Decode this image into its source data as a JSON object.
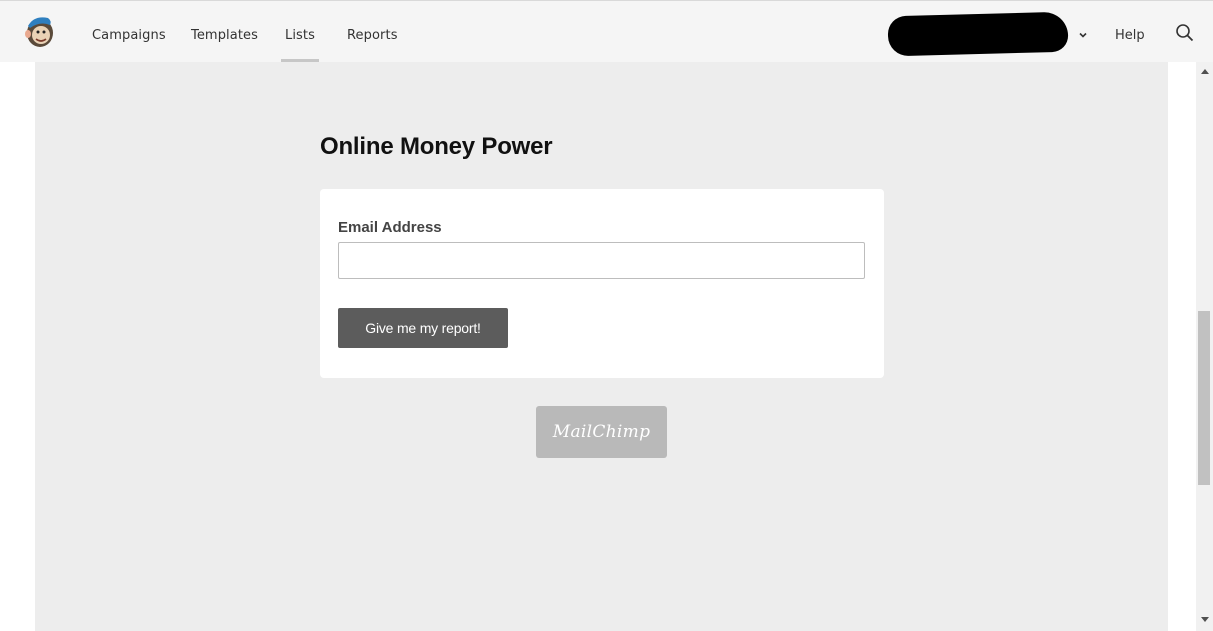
{
  "nav": {
    "items": [
      {
        "label": "Campaigns"
      },
      {
        "label": "Templates"
      },
      {
        "label": "Lists"
      },
      {
        "label": "Reports"
      }
    ],
    "active": "Lists",
    "help_label": "Help"
  },
  "icons": {
    "logo": "mailchimp-freddie-logo-icon",
    "account_menu": "chevron-down-icon",
    "search": "search-icon"
  },
  "form": {
    "title": "Online Money Power",
    "email_label": "Email Address",
    "email_value": "",
    "submit_label": "Give me my report!"
  },
  "badge": {
    "label": "MailChimp"
  },
  "colors": {
    "nav_bg": "#f5f5f5",
    "page_bg": "#ededed",
    "button_bg": "#5c5c5c",
    "badge_bg": "#b9b9b9"
  }
}
